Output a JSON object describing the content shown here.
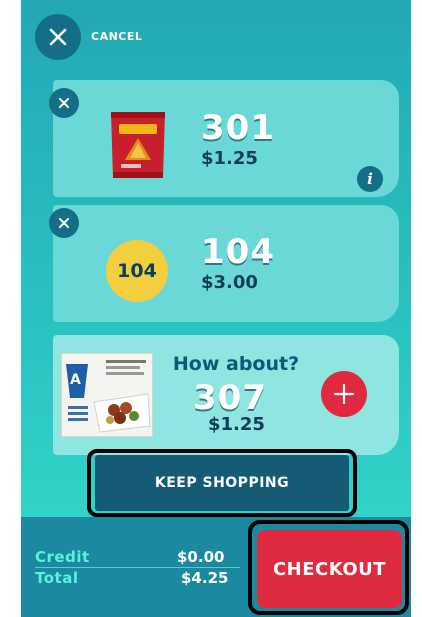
{
  "header": {
    "cancel_label": "CANCEL",
    "cancel_icon": "close-icon"
  },
  "cart": {
    "items": [
      {
        "code": "301",
        "price": "$1.25",
        "image": "chips-bag",
        "remove_icon": "close-icon",
        "info_label": "i"
      },
      {
        "code": "104",
        "price": "$3.00",
        "badge": "104",
        "remove_icon": "close-icon"
      }
    ],
    "suggestion": {
      "prompt": "How about?",
      "code": "307",
      "price": "$1.25",
      "add_icon": "plus-icon"
    }
  },
  "actions": {
    "keep_shopping": "KEEP SHOPPING",
    "checkout": "CHECKOUT"
  },
  "totals": {
    "credit_label": "Credit",
    "credit_value": "$0.00",
    "total_label": "Total",
    "total_value": "$4.25"
  },
  "colors": {
    "accent": "#146f86",
    "checkout": "#df2b3f",
    "badge": "#f3cf3f"
  }
}
